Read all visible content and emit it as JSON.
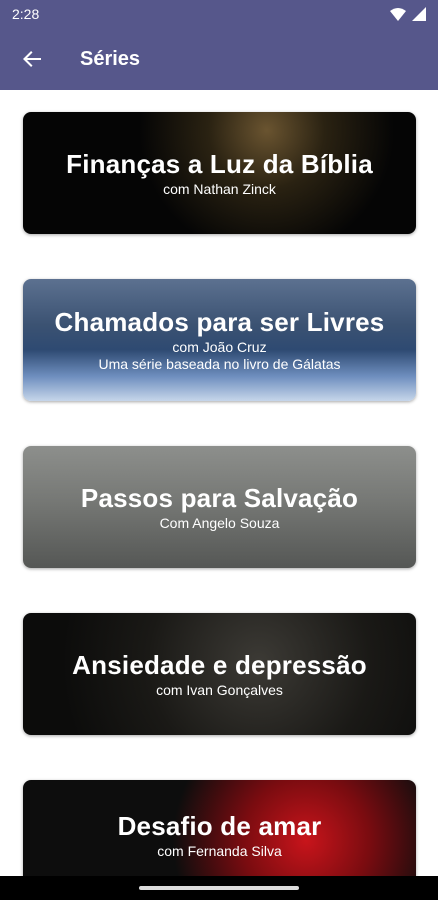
{
  "status_bar": {
    "time": "2:28"
  },
  "app_bar": {
    "title": "Séries"
  },
  "cards": [
    {
      "title": "Finanças a Luz da Bíblia",
      "subtitle": "com Nathan Zinck"
    },
    {
      "title": "Chamados para ser Livres",
      "subtitle": "com João Cruz",
      "subtitle2": "Uma série baseada no livro de Gálatas"
    },
    {
      "title": "Passos para Salvação",
      "subtitle": "Com Angelo Souza"
    },
    {
      "title": "Ansiedade e depressão",
      "subtitle": "com Ivan Gonçalves"
    },
    {
      "title": "Desafio de amar",
      "subtitle": "com Fernanda Silva"
    }
  ],
  "colors": {
    "app_bar": "#56578b",
    "text_on_card": "#ffffff"
  }
}
